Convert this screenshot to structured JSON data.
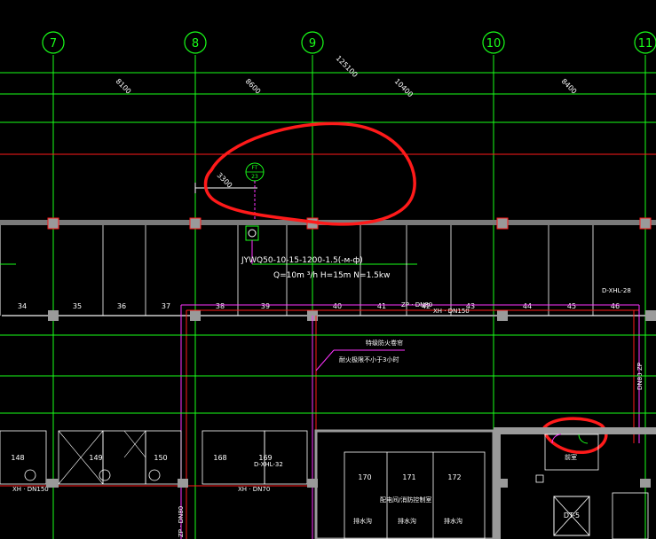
{
  "axes": [
    {
      "label": "7"
    },
    {
      "label": "8"
    },
    {
      "label": "9"
    },
    {
      "label": "10"
    },
    {
      "label": "11"
    }
  ],
  "dimensions": {
    "overall": "125100",
    "spans": [
      "8100",
      "8600",
      "10400",
      "8400"
    ],
    "offset": "3300"
  },
  "hydrant_symbol": {
    "top": "FT",
    "bottom": "23"
  },
  "pump": {
    "model": "JYWQ50-10-15-1200-1.5(-м-ф)",
    "specs": "Q=10m ³/h H=15m N=1.5kw"
  },
  "upper_bays": [
    "34",
    "35",
    "36",
    "37",
    "38",
    "39",
    "40",
    "41",
    "42",
    "43",
    "44",
    "45",
    "46"
  ],
  "lower_bays": [
    "148",
    "149",
    "150",
    "168",
    "169",
    "170",
    "171",
    "172"
  ],
  "pipes": {
    "zp": "ZP · DN80",
    "xh_upper": "XH · DN150",
    "xh_left": "XH · DN150",
    "xh_mid": "XH · DN70",
    "d_xhl_28": "D-XHL-28",
    "d_xhl_32": "D-XHL-32",
    "zp_vert": "ZP",
    "dn_vert": "DN80",
    "zp_bottom": "ZP · DN80"
  },
  "notes": {
    "line1": "特级防火卷帘",
    "line2": "耐火极限不小于3小时",
    "room_label": "配电间/消防控制室",
    "room_a": "排水沟",
    "room_b": "排水沟",
    "room_c": "排水沟",
    "elevator": "DT-5",
    "small_room": "前室"
  },
  "colors": {
    "axis_green": "#19ff19",
    "red": "#ff1a1a",
    "magenta": "#ff33ff",
    "grey_structure": "#9a9a9a",
    "white": "#ffffff"
  }
}
